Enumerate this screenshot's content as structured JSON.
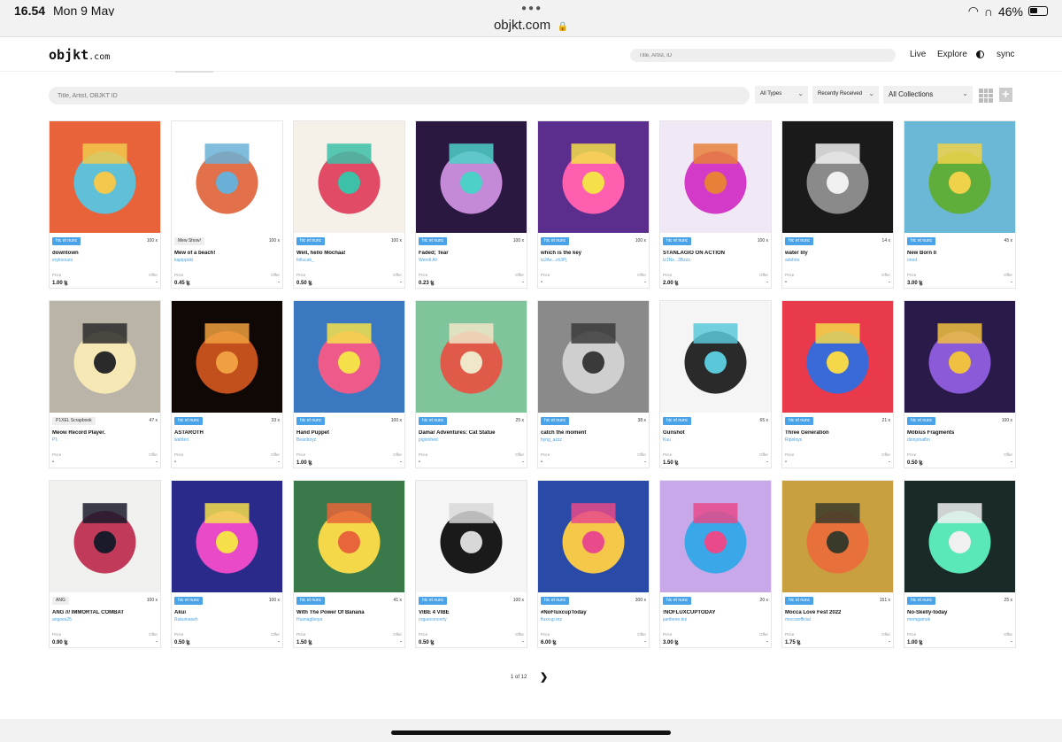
{
  "status_bar": {
    "time": "16.54",
    "date": "Mon 9 May",
    "battery": "46%"
  },
  "browser": {
    "url": "objkt.com"
  },
  "header": {
    "logo_main": "objkt",
    "logo_suffix": ".com",
    "search_placeholder": "Title, Artist, ID",
    "nav": {
      "live": "Live",
      "explore": "Explore",
      "sync": "sync"
    }
  },
  "filters": {
    "search_placeholder": "Title, Artist, OBJKT ID",
    "types": "All Types",
    "sort": "Recently Received",
    "collections": "All Collections"
  },
  "labels": {
    "price": "Price",
    "offer": "Offer"
  },
  "cards": [
    {
      "badge": "hic et nunc",
      "count": "100 x",
      "title": "downtown",
      "artist": "eryknouza",
      "price": "1.00 ꜩ",
      "offer": "-",
      "colors": [
        "#e8623a",
        "#5fc0d8",
        "#f2c94c"
      ]
    },
    {
      "badge": "Mew Show!",
      "count": "100 x",
      "title": "Mew of a beach!",
      "artist": "kapippoki",
      "price": "0.45 ꜩ",
      "offer": "-",
      "colors": [
        "#ffffff",
        "#e2704b",
        "#6ab0d6"
      ]
    },
    {
      "badge": "hic et nunc",
      "count": "100 x",
      "title": "Well, hello Mochaa!",
      "artist": "follucak_",
      "price": "0.50 ꜩ",
      "offer": "-",
      "colors": [
        "#f5f1e8",
        "#e24b66",
        "#3cc0a8"
      ]
    },
    {
      "badge": "hic et nunc",
      "count": "100 x",
      "title": "Faded; Tear",
      "artist": "Wendi Ali",
      "price": "0.23 ꜩ",
      "offer": "-",
      "colors": [
        "#2a1840",
        "#c48ad8",
        "#4dd0c8"
      ]
    },
    {
      "badge": "hic et nunc",
      "count": "100 x",
      "title": "which is the key",
      "artist": "tz2Ae...ch3Pj",
      "price": "-",
      "offer": "-",
      "colors": [
        "#5b2d8c",
        "#ff5fae",
        "#f5e04a"
      ]
    },
    {
      "badge": "hic et nunc",
      "count": "100 x",
      "title": "STANLAGIO ON ACTION",
      "artist": "tz1Nx...3Bzzu",
      "price": "2.00 ꜩ",
      "offer": "-",
      "colors": [
        "#f0e9f5",
        "#d43ac8",
        "#e8803a"
      ]
    },
    {
      "badge": "hic et nunc",
      "count": "14 x",
      "title": "water lily",
      "artist": "adsfoto",
      "price": "-",
      "offer": "-",
      "colors": [
        "#1a1a1a",
        "#8a8a8a",
        "#f0f0f0"
      ]
    },
    {
      "badge": "hic et nunc",
      "count": "45 x",
      "title": "New Born II",
      "artist": "onod",
      "price": "3.00 ꜩ",
      "offer": "-",
      "colors": [
        "#6ab8d6",
        "#5fae3c",
        "#f0d24a"
      ]
    },
    {
      "badge": "P1XEL Scrapbook",
      "count": "47 x",
      "title": "Meow Record Player.",
      "artist": "P1",
      "price": "-",
      "offer": "-",
      "colors": [
        "#b9b3a8",
        "#f5e8b4",
        "#2a2a2a"
      ]
    },
    {
      "badge": "hic et nunc",
      "count": "33 x",
      "title": "ASTAROTH",
      "artist": "wahteri",
      "price": "-",
      "offer": "-",
      "colors": [
        "#100805",
        "#c2501c",
        "#f0a040"
      ]
    },
    {
      "badge": "hic et nunc",
      "count": "100 x",
      "title": "Hand Puppet",
      "artist": "Beanboyz",
      "price": "1.00 ꜩ",
      "offer": "-",
      "colors": [
        "#3a78c0",
        "#ee5a8a",
        "#f5e04a"
      ]
    },
    {
      "badge": "hic et nunc",
      "count": "25 x",
      "title": "Damar Adventures: Cat Statue",
      "artist": "pigionhed",
      "price": "-",
      "offer": "-",
      "colors": [
        "#7fc49a",
        "#e05a4a",
        "#f0e6c8"
      ]
    },
    {
      "badge": "hic et nunc",
      "count": "38 x",
      "title": "catch the moment",
      "artist": "byng_azzz",
      "price": "-",
      "offer": "-",
      "colors": [
        "#8a8a8a",
        "#cfcfcf",
        "#3a3a3a"
      ]
    },
    {
      "badge": "hic et nunc",
      "count": "65 x",
      "title": "Gunshot",
      "artist": "Kuu",
      "price": "1.50 ꜩ",
      "offer": "-",
      "colors": [
        "#f5f5f5",
        "#2a2a2a",
        "#5ac8d8"
      ]
    },
    {
      "badge": "hic et nunc",
      "count": "21 x",
      "title": "Three Generation",
      "artist": "Ripoloys",
      "price": "-",
      "offer": "-",
      "colors": [
        "#e83a4a",
        "#3a6ad8",
        "#f5d84a"
      ]
    },
    {
      "badge": "hic et nunc",
      "count": "100 x",
      "title": "Möbius Fragments",
      "artist": "dionjonathn",
      "price": "0.50 ꜩ",
      "offer": "-",
      "colors": [
        "#2a1a4a",
        "#8a5ad8",
        "#f0c040"
      ]
    },
    {
      "badge": "ANG",
      "count": "100 x",
      "title": "ANG /// IMMORTAL COMBAT",
      "artist": "angoes25",
      "price": "0.90 ꜩ",
      "offer": "-",
      "colors": [
        "#f0f0ee",
        "#c23a5a",
        "#1a1a2a"
      ]
    },
    {
      "badge": "hic et nunc",
      "count": "100 x",
      "title": "Akui",
      "artist": "Rukumaseh",
      "price": "0.50 ꜩ",
      "offer": "-",
      "colors": [
        "#2a2a8a",
        "#e84ac8",
        "#f5e04a"
      ]
    },
    {
      "badge": "hic et nunc",
      "count": "41 x",
      "title": "With The Power Of Banana",
      "artist": "Husnagiboya",
      "price": "1.50 ꜩ",
      "offer": "-",
      "colors": [
        "#3a7a4a",
        "#f5d84a",
        "#e8643a"
      ]
    },
    {
      "badge": "hic et nunc",
      "count": "100 x",
      "title": "VIBE 4 VIBE",
      "artist": "rogueconcerty",
      "price": "0.50 ꜩ",
      "offer": "-",
      "colors": [
        "#f5f5f5",
        "#1a1a1a",
        "#d8d8d8"
      ]
    },
    {
      "badge": "hic et nunc",
      "count": "300 x",
      "title": "#NoFluxcupToday",
      "artist": "fluxcup.tez",
      "price": "6.00 ꜩ",
      "offer": "-",
      "colors": [
        "#2a4aa8",
        "#f5c84a",
        "#e84a8a"
      ]
    },
    {
      "badge": "hic et nunc",
      "count": "20 x",
      "title": "!NOFLUXCUPTODAY",
      "artist": "jambene.tez",
      "price": "3.00 ꜩ",
      "offer": "-",
      "colors": [
        "#c8a8e8",
        "#3aa8e8",
        "#e84a8a"
      ]
    },
    {
      "badge": "hic et nunc",
      "count": "151 x",
      "title": "Mocca Love Fest 2022",
      "artist": "moccaofficial",
      "price": "1.75 ꜩ",
      "offer": "-",
      "colors": [
        "#c8a040",
        "#e8703a",
        "#3a3a2a"
      ]
    },
    {
      "badge": "hic et nunc",
      "count": "25 x",
      "title": "No-Skelly-today",
      "artist": "memgamuk",
      "price": "1.00 ꜩ",
      "offer": "-",
      "colors": [
        "#1a2a28",
        "#5ae8b8",
        "#f0f0f0"
      ]
    }
  ],
  "pagination": {
    "text": "1 of 12",
    "next": "❯"
  }
}
